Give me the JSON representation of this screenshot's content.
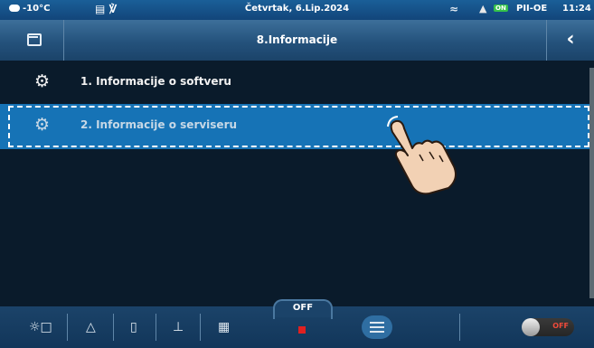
{
  "status_bar": {
    "temperature": "-10°C",
    "date": "Četvrtak, 6.Lip.2024",
    "on_badge": "ON",
    "mode": "PII-OE",
    "time": "11:24"
  },
  "title_bar": {
    "title": "8.Informacije"
  },
  "menu": {
    "items": [
      {
        "label": "1. Informacije o softveru"
      },
      {
        "label": "2. Informacije o serviseru"
      }
    ]
  },
  "bottom_bar": {
    "state_label": "OFF",
    "toggle_label": "OFF"
  },
  "icons": {
    "status_left": "cloud-icon",
    "gear": "gear-icon",
    "back": "chevron-left-icon",
    "folder": "folder-icon"
  },
  "colors": {
    "selected_row": "#1673b6",
    "background": "#0a1b2b",
    "stop_indicator": "#e02020",
    "on_badge": "#35c24a"
  }
}
